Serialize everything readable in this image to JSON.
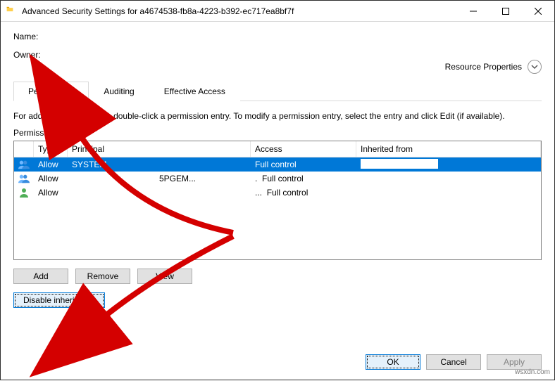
{
  "title": "Advanced Security Settings for a4674538-fb8a-4223-b392-ec717ea8bf7f",
  "labels": {
    "name": "Name:",
    "owner": "Owner:",
    "resource_properties": "Resource Properties"
  },
  "tabs": {
    "permissions": "Permissions",
    "auditing": "Auditing",
    "effective_access": "Effective Access"
  },
  "help_text": "For additional information, double-click a permission entry. To modify a permission entry, select the entry and click Edit (if available).",
  "entries_label": "Permission entries:",
  "columns": {
    "type": "Type",
    "principal": "Principal",
    "access": "Access",
    "inherited": "Inherited from"
  },
  "entries": [
    {
      "type": "Allow",
      "principal": "SYSTEM",
      "access": "Full control",
      "icon": "group",
      "selected": true
    },
    {
      "type": "Allow",
      "principal": "5PGEM...",
      "access": "Full control",
      "icon": "group",
      "selected": false,
      "dotprefix": "."
    },
    {
      "type": "Allow",
      "principal": "",
      "access": "Full control",
      "icon": "person",
      "selected": false,
      "dotprefix": "..."
    }
  ],
  "buttons": {
    "add": "Add",
    "remove": "Remove",
    "view": "View",
    "disable_inheritance": "Disable inheritance",
    "ok": "OK",
    "cancel": "Cancel",
    "apply": "Apply"
  },
  "watermark": "wsxdn.com"
}
